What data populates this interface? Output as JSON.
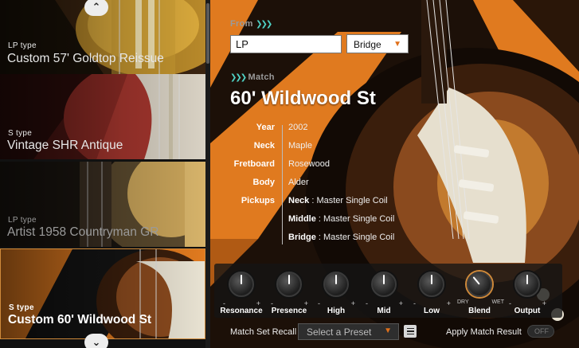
{
  "sidebar": {
    "items": [
      {
        "type": "LP type",
        "name": "Custom 57' Goldtop Reissue",
        "state": "normal"
      },
      {
        "type": "S type",
        "name": "Vintage SHR Antique",
        "state": "normal"
      },
      {
        "type": "LP type",
        "name": "Artist 1958 Countryman GR",
        "state": "dim"
      },
      {
        "type": "S type",
        "name": "Custom 60' Wildwood St",
        "state": "selected"
      }
    ],
    "scroll_up_icon": "chevron-up-icon",
    "scroll_down_icon": "chevron-down-icon"
  },
  "from": {
    "label": "From",
    "input_value": "LP",
    "pickup": {
      "selected": "Bridge"
    }
  },
  "match": {
    "label": "Match",
    "title": "60' Wildwood St",
    "specs": [
      {
        "key": "Year",
        "value": "2002"
      },
      {
        "key": "Neck",
        "value": "Maple"
      },
      {
        "key": "Fretboard",
        "value": "Rosewood"
      },
      {
        "key": "Body",
        "value": "Alder"
      },
      {
        "key": "Pickups",
        "position": "Neck",
        "sep": " : ",
        "value": "Master Single Coil"
      },
      {
        "key": "",
        "position": "Middle",
        "sep": " : ",
        "value": "Master Single Coil"
      },
      {
        "key": "",
        "position": "Bridge",
        "sep": " : ",
        "value": "Master Single Coil"
      }
    ]
  },
  "knobs": [
    {
      "label": "Resonance",
      "min": "-",
      "max": "+"
    },
    {
      "label": "Presence",
      "min": "-",
      "max": "+"
    },
    {
      "label": "High",
      "min": "-",
      "max": "+"
    },
    {
      "label": "Mid",
      "min": "-",
      "max": "+"
    },
    {
      "label": "Low",
      "min": "-",
      "max": "+"
    },
    {
      "label": "Blend",
      "min": "DRY",
      "max": "WET"
    },
    {
      "label": "Output",
      "min": "-",
      "max": "+"
    }
  ],
  "bottom": {
    "recall_label": "Match Set Recall",
    "preset_placeholder": "Select a Preset",
    "apply_label": "Apply Match Result",
    "apply_toggle": "OFF"
  },
  "colors": {
    "accent_orange": "#e0701b",
    "accent_teal": "#4fd1c5",
    "selection_border": "#d08a3a"
  }
}
